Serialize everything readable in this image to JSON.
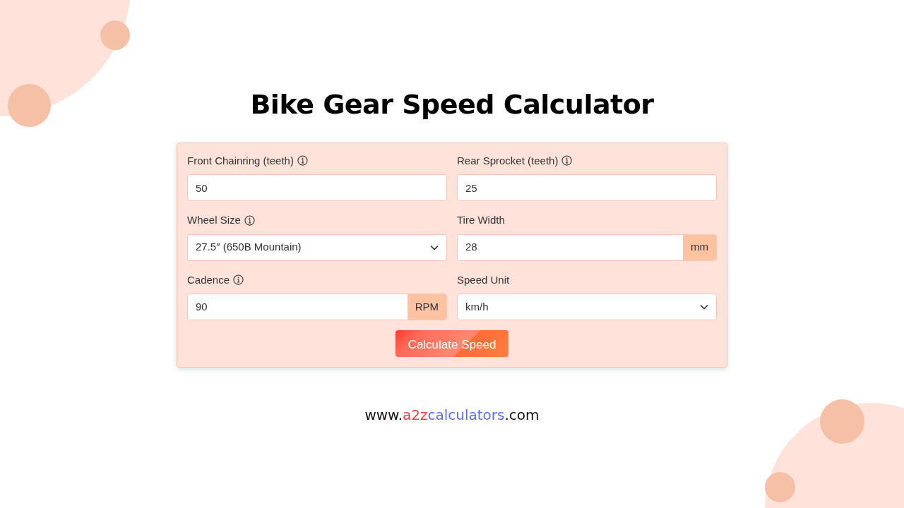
{
  "title": "Bike Gear Speed Calculator",
  "fields": [
    {
      "label": "Front Chainring (teeth)",
      "info": true,
      "kind": "text",
      "value": "50"
    },
    {
      "label": "Rear Sprocket (teeth)",
      "info": true,
      "kind": "text",
      "value": "25"
    },
    {
      "label": "Wheel Size",
      "info": true,
      "kind": "select",
      "value": "27.5″ (650B Mountain)"
    },
    {
      "label": "Tire Width",
      "info": false,
      "kind": "addon",
      "value": "28",
      "unit": "mm"
    },
    {
      "label": "Cadence",
      "info": true,
      "kind": "addon",
      "value": "90",
      "unit": "RPM"
    },
    {
      "label": "Speed Unit",
      "info": false,
      "kind": "select",
      "value": "km/h"
    }
  ],
  "button": "Calculate Speed",
  "footer": [
    {
      "text": "www.",
      "color": "#111111"
    },
    {
      "text": "a2z",
      "color": "#f23d3d"
    },
    {
      "text": "calculators",
      "color": "#5a6ff0"
    },
    {
      "text": ".com",
      "color": "#111111"
    }
  ]
}
